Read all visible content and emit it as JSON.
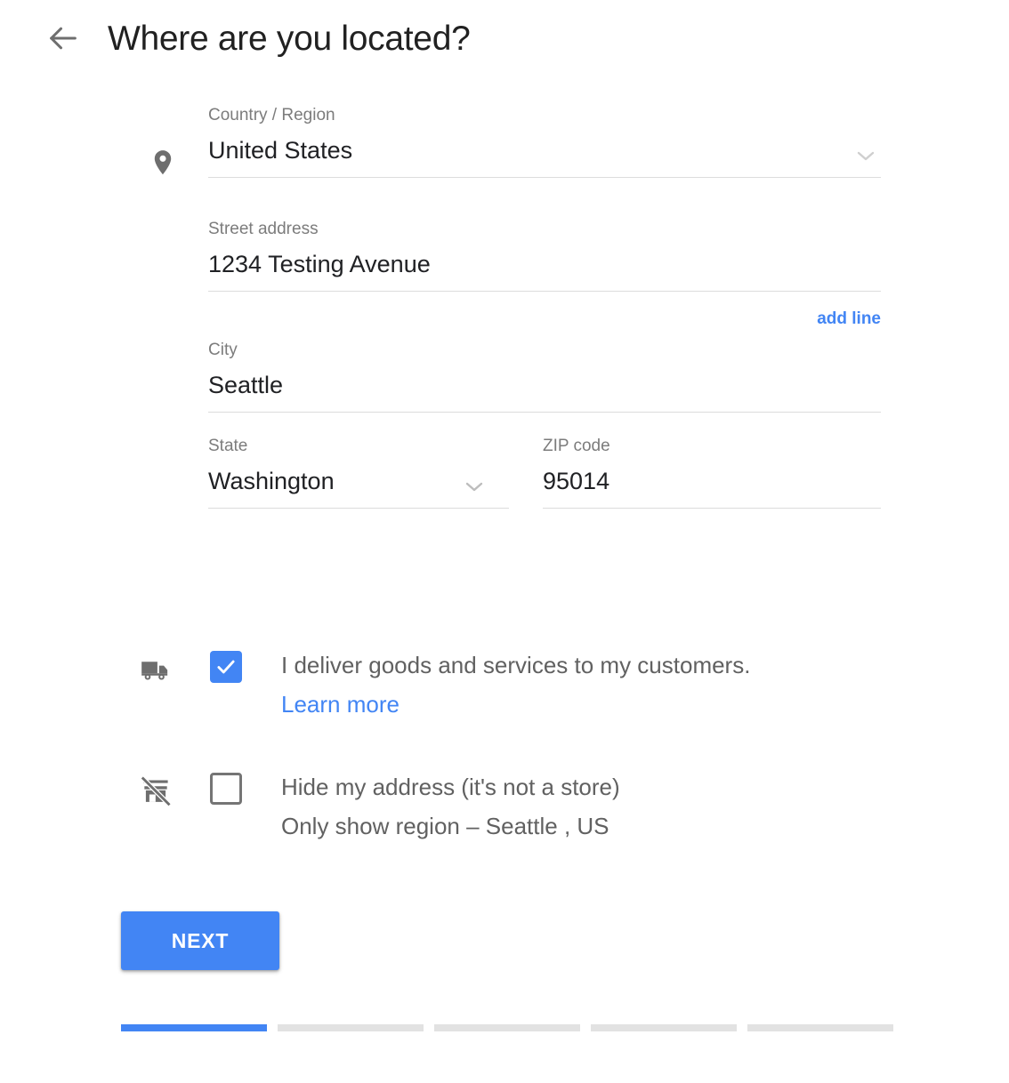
{
  "header": {
    "back_icon": "arrow-left-icon",
    "title": "Where are you located?"
  },
  "form": {
    "country": {
      "icon": "location-pin-icon",
      "label": "Country / Region",
      "value": "United States",
      "dropdown_icon": "chevron-down-icon"
    },
    "street": {
      "label": "Street address",
      "value": "1234 Testing Avenue"
    },
    "add_line_label": "add line",
    "city": {
      "label": "City",
      "value": "Seattle"
    },
    "state": {
      "label": "State",
      "value": "Washington",
      "dropdown_icon": "chevron-down-icon"
    },
    "zip": {
      "label": "ZIP code",
      "value": "95014"
    }
  },
  "options": {
    "delivery": {
      "icon": "delivery-truck-icon",
      "checked": true,
      "checkmark_icon": "check-icon",
      "label": "I deliver goods and services to my customers.",
      "link_label": "Learn more"
    },
    "hide_address": {
      "icon": "store-off-icon",
      "checked": false,
      "label": "Hide my address (it's not a store)",
      "sublabel": "Only show region – Seattle , US"
    }
  },
  "footer": {
    "next_label": "NEXT",
    "progress": {
      "total_steps": 5,
      "current_step": 1
    }
  },
  "colors": {
    "accent": "#4285f4",
    "title_text": "#212124",
    "label_text": "#7c7c7c",
    "value_text": "#202124",
    "option_text": "#616161",
    "underline": "#dcdcdc",
    "progress_inactive": "#e2e2e2",
    "icon_gray": "#6e6e6e"
  }
}
